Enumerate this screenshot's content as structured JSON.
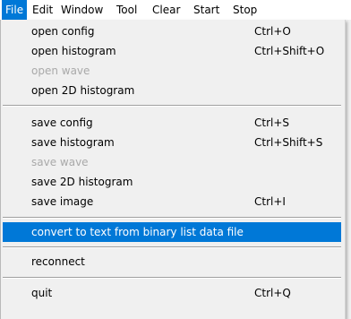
{
  "menubar": {
    "items": [
      "File",
      "Edit",
      "Window",
      "Tool",
      "Clear",
      "Start",
      "Stop"
    ],
    "active": "File"
  },
  "file_menu": {
    "open_config": {
      "label": "open config",
      "shortcut": "Ctrl+O"
    },
    "open_histogram": {
      "label": "open histogram",
      "shortcut": "Ctrl+Shift+O"
    },
    "open_wave": {
      "label": "open wave",
      "enabled": false
    },
    "open_2d_histogram": {
      "label": "open 2D histogram"
    },
    "save_config": {
      "label": "save config",
      "shortcut": "Ctrl+S"
    },
    "save_histogram": {
      "label": "save histogram",
      "shortcut": "Ctrl+Shift+S"
    },
    "save_wave": {
      "label": "save wave",
      "enabled": false
    },
    "save_2d_histogram": {
      "label": "save 2D histogram"
    },
    "save_image": {
      "label": "save image",
      "shortcut": "Ctrl+I"
    },
    "convert_to_text": {
      "label": "convert to text from binary list data file",
      "highlighted": true
    },
    "reconnect": {
      "label": "reconnect"
    },
    "quit": {
      "label": "quit",
      "shortcut": "Ctrl+Q"
    }
  },
  "colors": {
    "highlight": "#0078d7",
    "highlight_text": "#ffffff",
    "menu_background": "#f0f0f0",
    "disabled_text": "#a9a9a9"
  }
}
